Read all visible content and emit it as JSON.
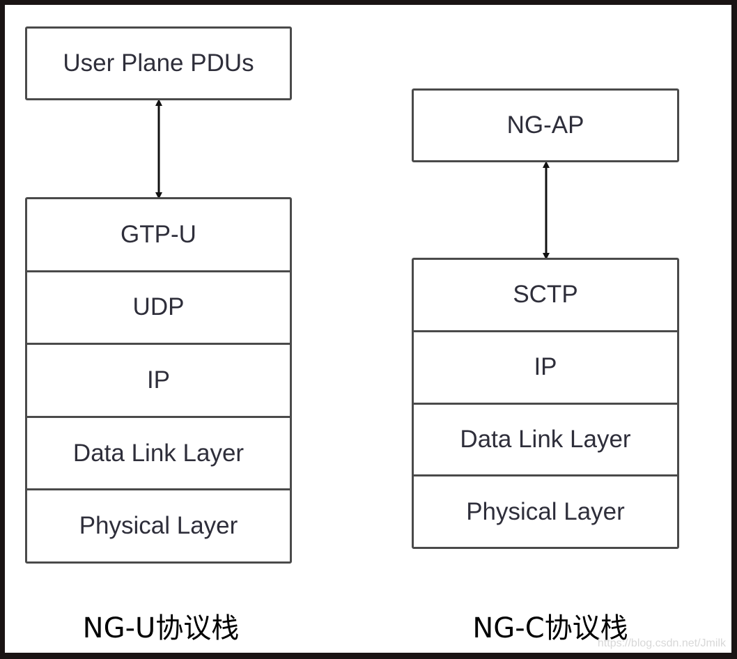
{
  "ng_u": {
    "top": "User Plane PDUs",
    "layers": [
      "GTP-U",
      "UDP",
      "IP",
      "Data Link Layer",
      "Physical Layer"
    ],
    "caption": "NG-U协议栈"
  },
  "ng_c": {
    "top": "NG-AP",
    "layers": [
      "SCTP",
      "IP",
      "Data Link Layer",
      "Physical Layer"
    ],
    "caption": "NG-C协议栈"
  },
  "watermark": "https://blog.csdn.net/Jmilk"
}
